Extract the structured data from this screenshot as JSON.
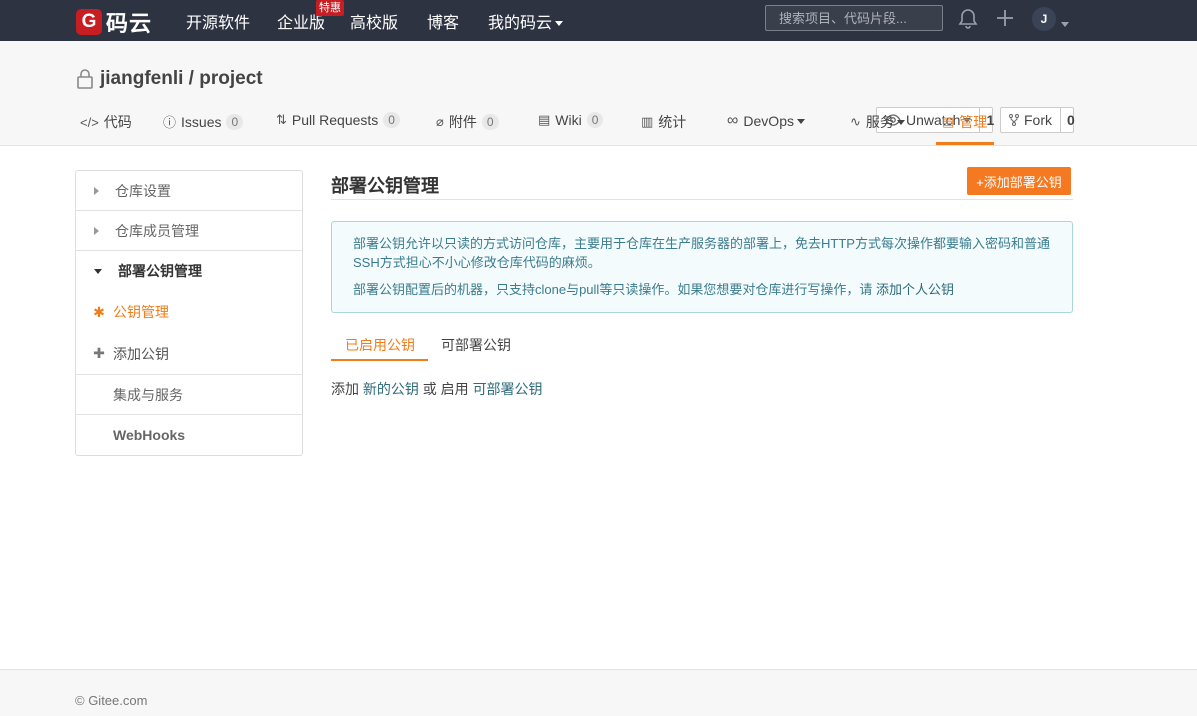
{
  "nav": {
    "logo_mark": "G",
    "logo_text": "码云",
    "links": [
      "开源软件",
      "企业版",
      "高校版",
      "博客",
      "我的码云"
    ],
    "badge": "特惠",
    "search_placeholder": "搜索项目、代码片段...",
    "avatar": "J"
  },
  "repo": {
    "owner": "jiangfenli",
    "sep": " / ",
    "name": "project",
    "watch_label": "Unwatch",
    "watch_count": "1",
    "fork_label": "Fork",
    "fork_count": "0"
  },
  "tabs": [
    {
      "label": "代码",
      "icon": "code-icon"
    },
    {
      "label": "Issues",
      "count": "0",
      "icon": "issue-icon"
    },
    {
      "label": "Pull Requests",
      "count": "0",
      "icon": "pull-request-icon"
    },
    {
      "label": "附件",
      "count": "0",
      "icon": "attachment-icon"
    },
    {
      "label": "Wiki",
      "count": "0",
      "icon": "wiki-icon"
    },
    {
      "label": "统计",
      "icon": "stats-icon"
    },
    {
      "label": "DevOps",
      "icon": "devops-icon"
    },
    {
      "label": "服务",
      "icon": "service-icon"
    },
    {
      "label": "管理",
      "icon": "manage-icon"
    }
  ],
  "sidebar": {
    "items": [
      "仓库设置",
      "仓库成员管理",
      "部署公钥管理"
    ],
    "subs": [
      "公钥管理",
      "添加公钥"
    ],
    "plain": [
      "集成与服务",
      "WebHooks"
    ]
  },
  "main": {
    "title": "部署公钥管理",
    "add_button": "+添加部署公钥",
    "info_p1": "部署公钥允许以只读的方式访问仓库，主要用于仓库在生产服务器的部署上，免去HTTP方式每次操作都要输入密码和普通SSH方式担心不小心修改仓库代码的麻烦。",
    "info_p2_prefix": "部署公钥配置后的机器，只支持clone与pull等只读操作。如果您想要对仓库进行写操作，请 ",
    "info_p2_link": "添加个人公钥",
    "subtabs": [
      "已启用公钥",
      "可部署公钥"
    ],
    "hint_1": "添加 ",
    "hint_link_1": "新的公钥",
    "hint_2": " 或 启用 ",
    "hint_link_2": "可部署公钥"
  },
  "footer": "© Gitee.com",
  "colors": {
    "accent": "#f07d1a",
    "nav_bg": "#2e3341",
    "brand": "#c71d23"
  }
}
